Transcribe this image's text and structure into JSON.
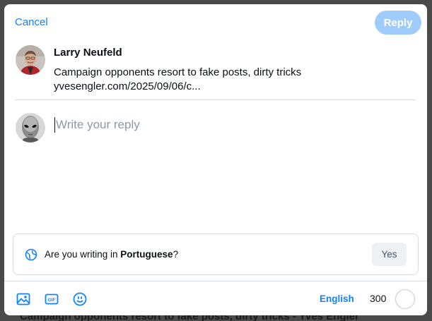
{
  "backdrop": {
    "text": "Campaign opponents resort to fake posts, dirty tricks - Yves Engler"
  },
  "header": {
    "cancel_label": "Cancel",
    "reply_label": "Reply"
  },
  "quoted_post": {
    "author": "Larry Neufeld",
    "text": "Campaign opponents resort to fake posts, dirty tricks",
    "link": "yvesengler.com/2025/09/06/c..."
  },
  "composer": {
    "placeholder": "Write your reply"
  },
  "language_prompt": {
    "prefix": "Are you writing in ",
    "language": "Portuguese",
    "suffix": "?",
    "yes_label": "Yes"
  },
  "toolbar": {
    "icons": [
      "image-icon",
      "gif-icon",
      "emoji-icon"
    ],
    "language_label": "English",
    "char_remaining": "300",
    "progress": 0
  },
  "colors": {
    "accent": "#1083fe",
    "reply_disabled": "#9fccfb",
    "border": "#d4dbe2",
    "placeholder": "#8d99a6"
  }
}
